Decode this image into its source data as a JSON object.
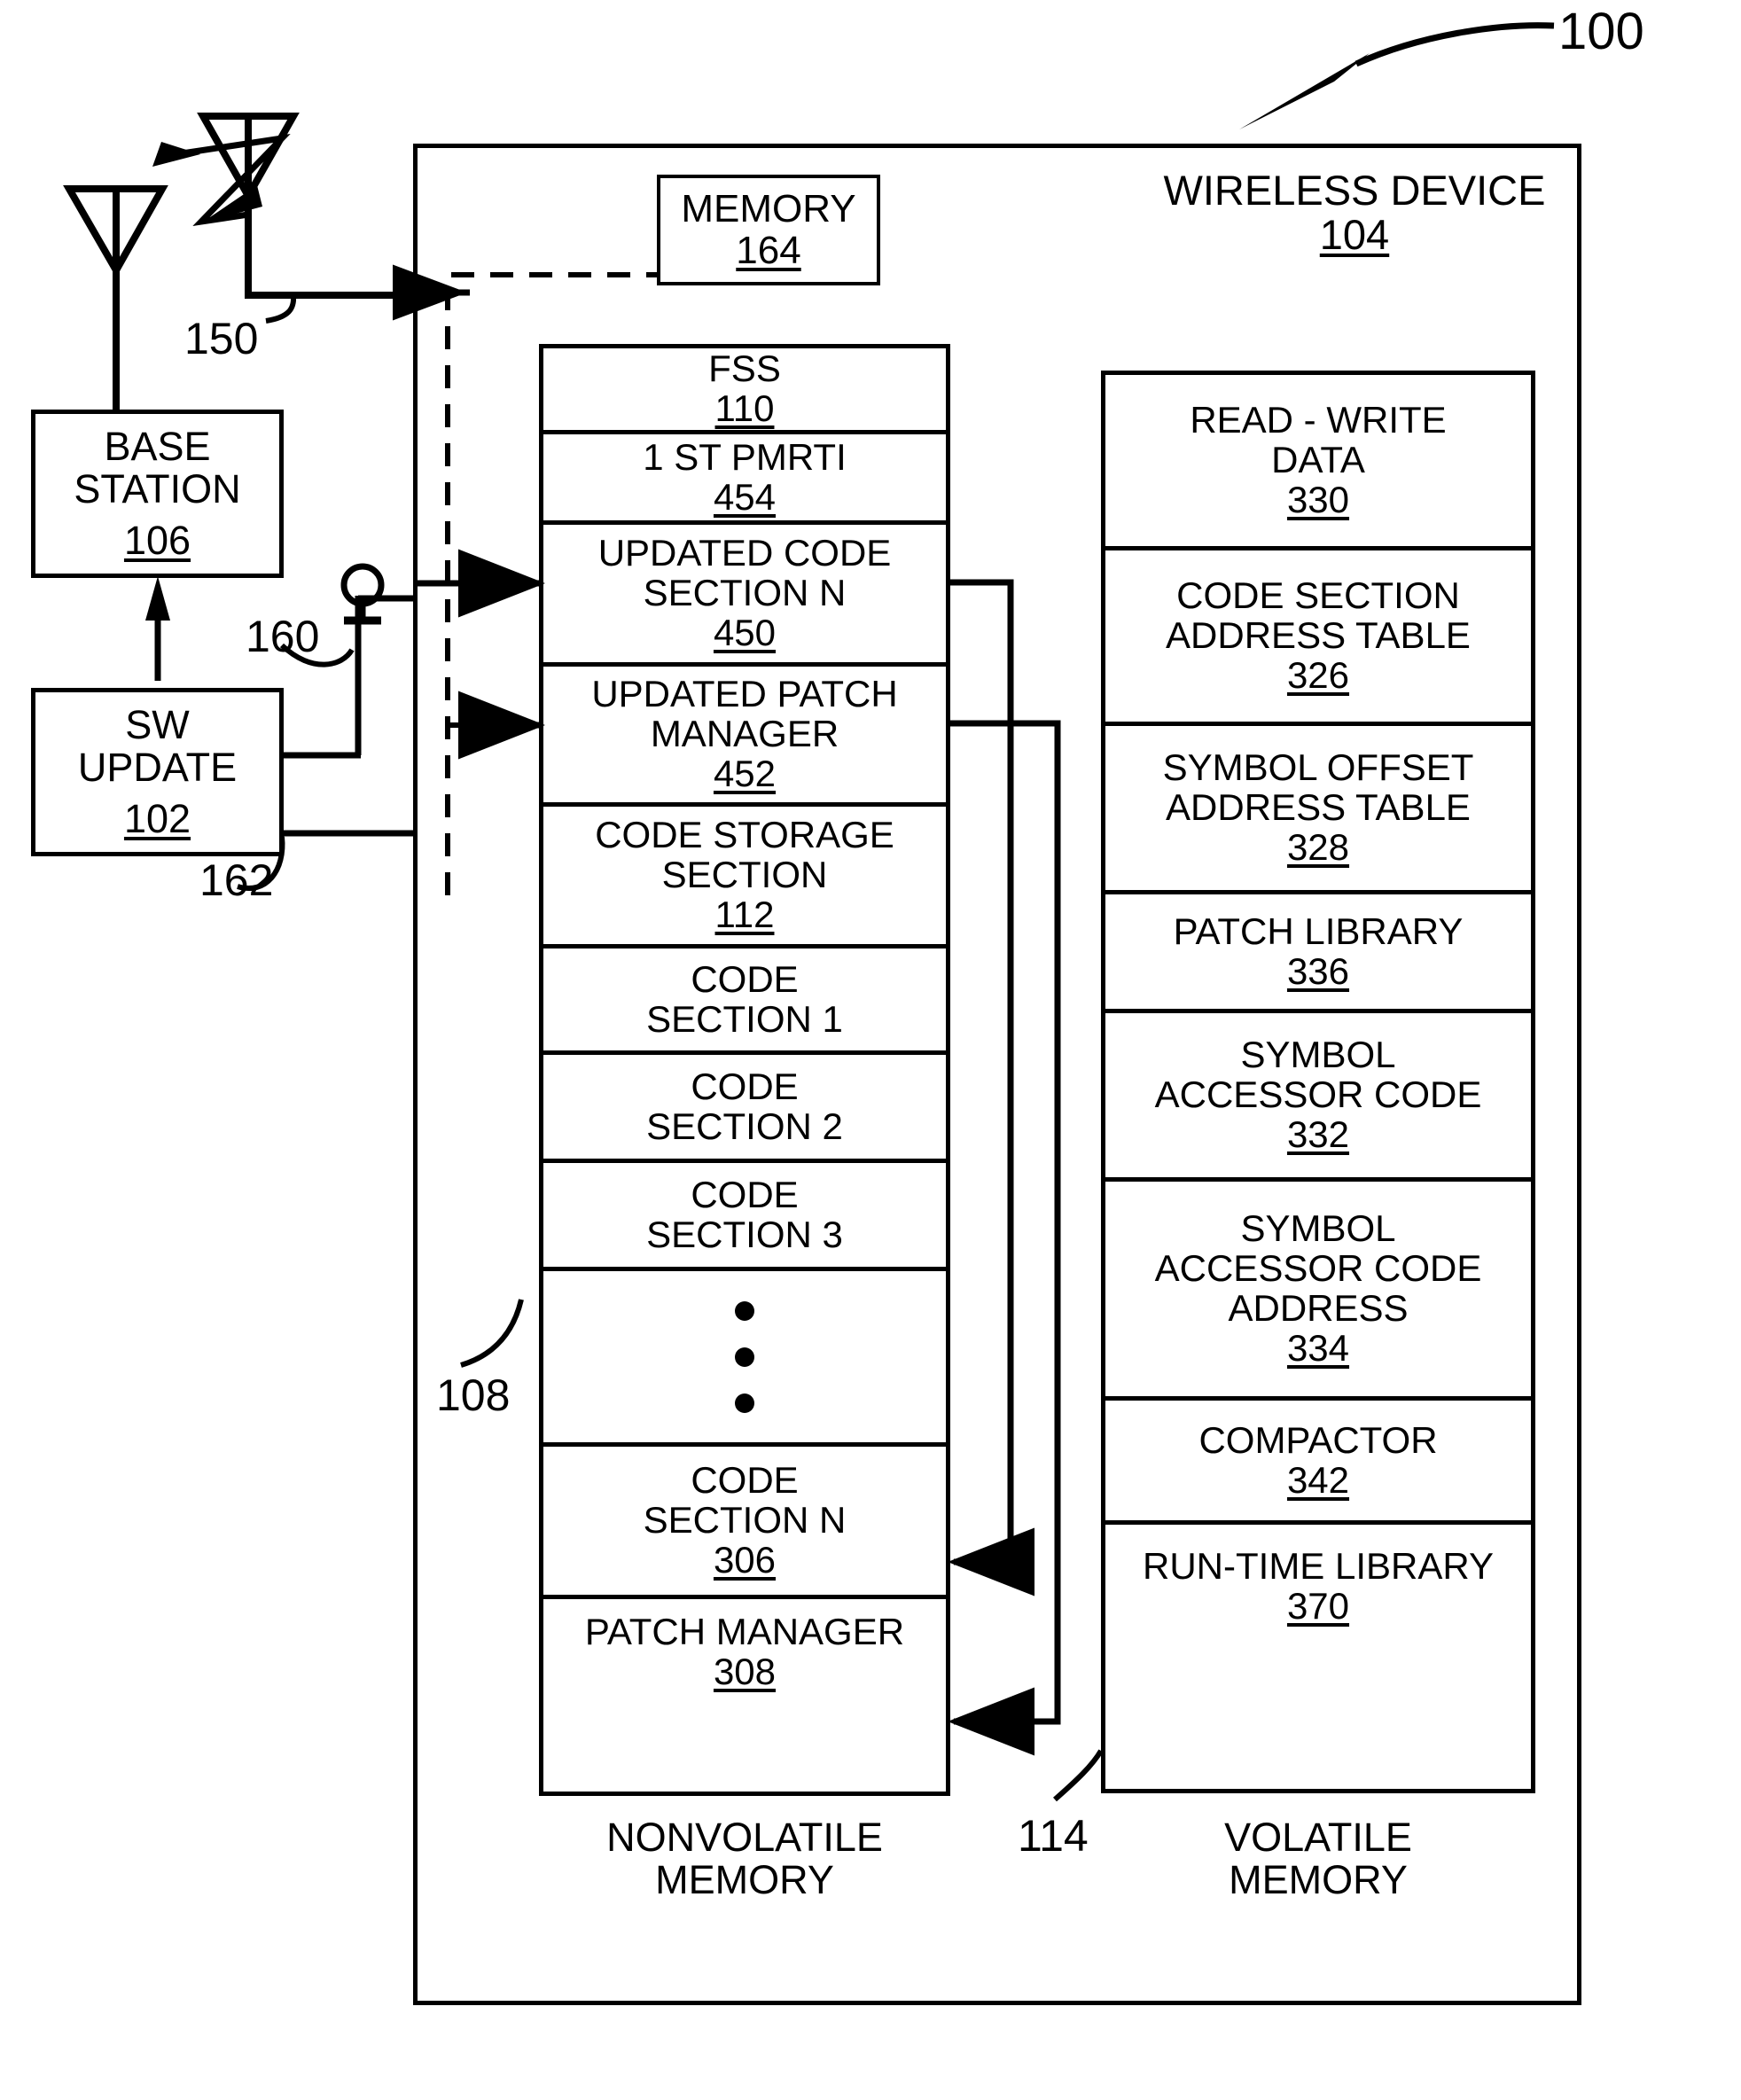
{
  "figure": {
    "ref_number": "100"
  },
  "left": {
    "antennas": [
      {
        "name": "remote-antenna"
      },
      {
        "name": "base-station-antenna"
      }
    ],
    "signal_label": "150",
    "base_station": {
      "title_line1": "BASE",
      "title_line2": "STATION",
      "ref": "106"
    },
    "sw_update": {
      "title_line1": "SW",
      "title_line2": "UPDATE",
      "ref": "102"
    },
    "wire_labels": {
      "upper": "160",
      "lower": "162"
    }
  },
  "device": {
    "title": "WIRELESS DEVICE",
    "ref": "104",
    "memory_box": {
      "title": "MEMORY",
      "ref": "164"
    },
    "nonvolatile": {
      "footer_line1": "NONVOLATILE",
      "footer_line2": "MEMORY",
      "callout": "108",
      "cells": [
        {
          "lines": [
            "FSS"
          ],
          "ref": "110"
        },
        {
          "lines": [
            "1 ST PMRTI"
          ],
          "ref": "454"
        },
        {
          "lines": [
            "UPDATED CODE",
            "SECTION  N"
          ],
          "ref": "450"
        },
        {
          "lines": [
            "UPDATED PATCH",
            "MANAGER"
          ],
          "ref": "452"
        },
        {
          "lines": [
            "CODE STORAGE",
            "SECTION"
          ],
          "ref": "112"
        },
        {
          "lines": [
            "CODE",
            "SECTION  1"
          ],
          "ref": ""
        },
        {
          "lines": [
            "CODE",
            "SECTION  2"
          ],
          "ref": ""
        },
        {
          "lines": [
            "CODE",
            "SECTION  3"
          ],
          "ref": ""
        },
        {
          "lines": [
            "•",
            "•",
            "•"
          ],
          "ref": "",
          "is_dots": true
        },
        {
          "lines": [
            "CODE",
            "SECTION  N"
          ],
          "ref": "306"
        },
        {
          "lines": [
            "PATCH MANAGER"
          ],
          "ref": "308"
        }
      ]
    },
    "volatile": {
      "footer_line1": "VOLATILE",
      "footer_line2": "MEMORY",
      "callout": "114",
      "cells": [
        {
          "lines": [
            "READ - WRITE",
            "DATA"
          ],
          "ref": "330"
        },
        {
          "lines": [
            "CODE SECTION",
            "ADDRESS TABLE"
          ],
          "ref": "326"
        },
        {
          "lines": [
            "SYMBOL OFFSET",
            "ADDRESS TABLE"
          ],
          "ref": "328"
        },
        {
          "lines": [
            "PATCH  LIBRARY"
          ],
          "ref": "336"
        },
        {
          "lines": [
            "SYMBOL",
            "ACCESSOR CODE"
          ],
          "ref": "332"
        },
        {
          "lines": [
            "SYMBOL",
            "ACCESSOR CODE",
            "ADDRESS"
          ],
          "ref": "334"
        },
        {
          "lines": [
            "COMPACTOR"
          ],
          "ref": "342"
        },
        {
          "lines": [
            "RUN-TIME LIBRARY"
          ],
          "ref": "370"
        }
      ]
    }
  }
}
